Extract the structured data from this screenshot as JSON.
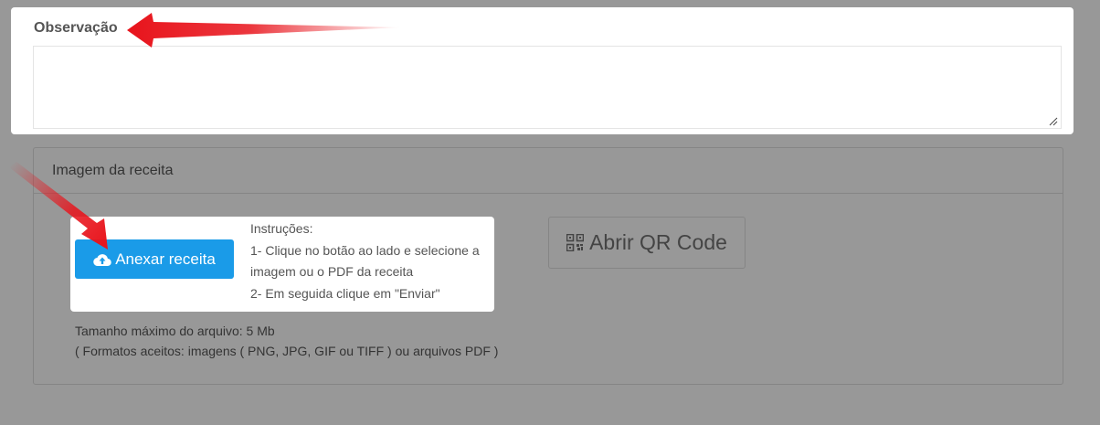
{
  "observation": {
    "label": "Observação",
    "value": "",
    "placeholder": ""
  },
  "receipt_panel": {
    "title": "Imagem da receita",
    "attach_button_label": "Anexar receita",
    "instructions": [
      "Instruções:",
      "1- Clique no botão ao lado e selecione a",
      "imagem ou o PDF da receita",
      "2- Em seguida clique em \"Enviar\""
    ],
    "qr_button_label": "Abrir QR Code",
    "file_info": [
      "Tamanho máximo do arquivo: 5 Mb",
      "( Formatos aceitos: imagens ( PNG, JPG, GIF ou TIFF ) ou arquivos PDF )"
    ]
  },
  "icons": {
    "attach": "cloud-upload-icon",
    "qr": "qr-code-icon"
  },
  "colors": {
    "background": "#989898",
    "attach_button": "#1a9be8",
    "arrow": "#e8141c"
  }
}
